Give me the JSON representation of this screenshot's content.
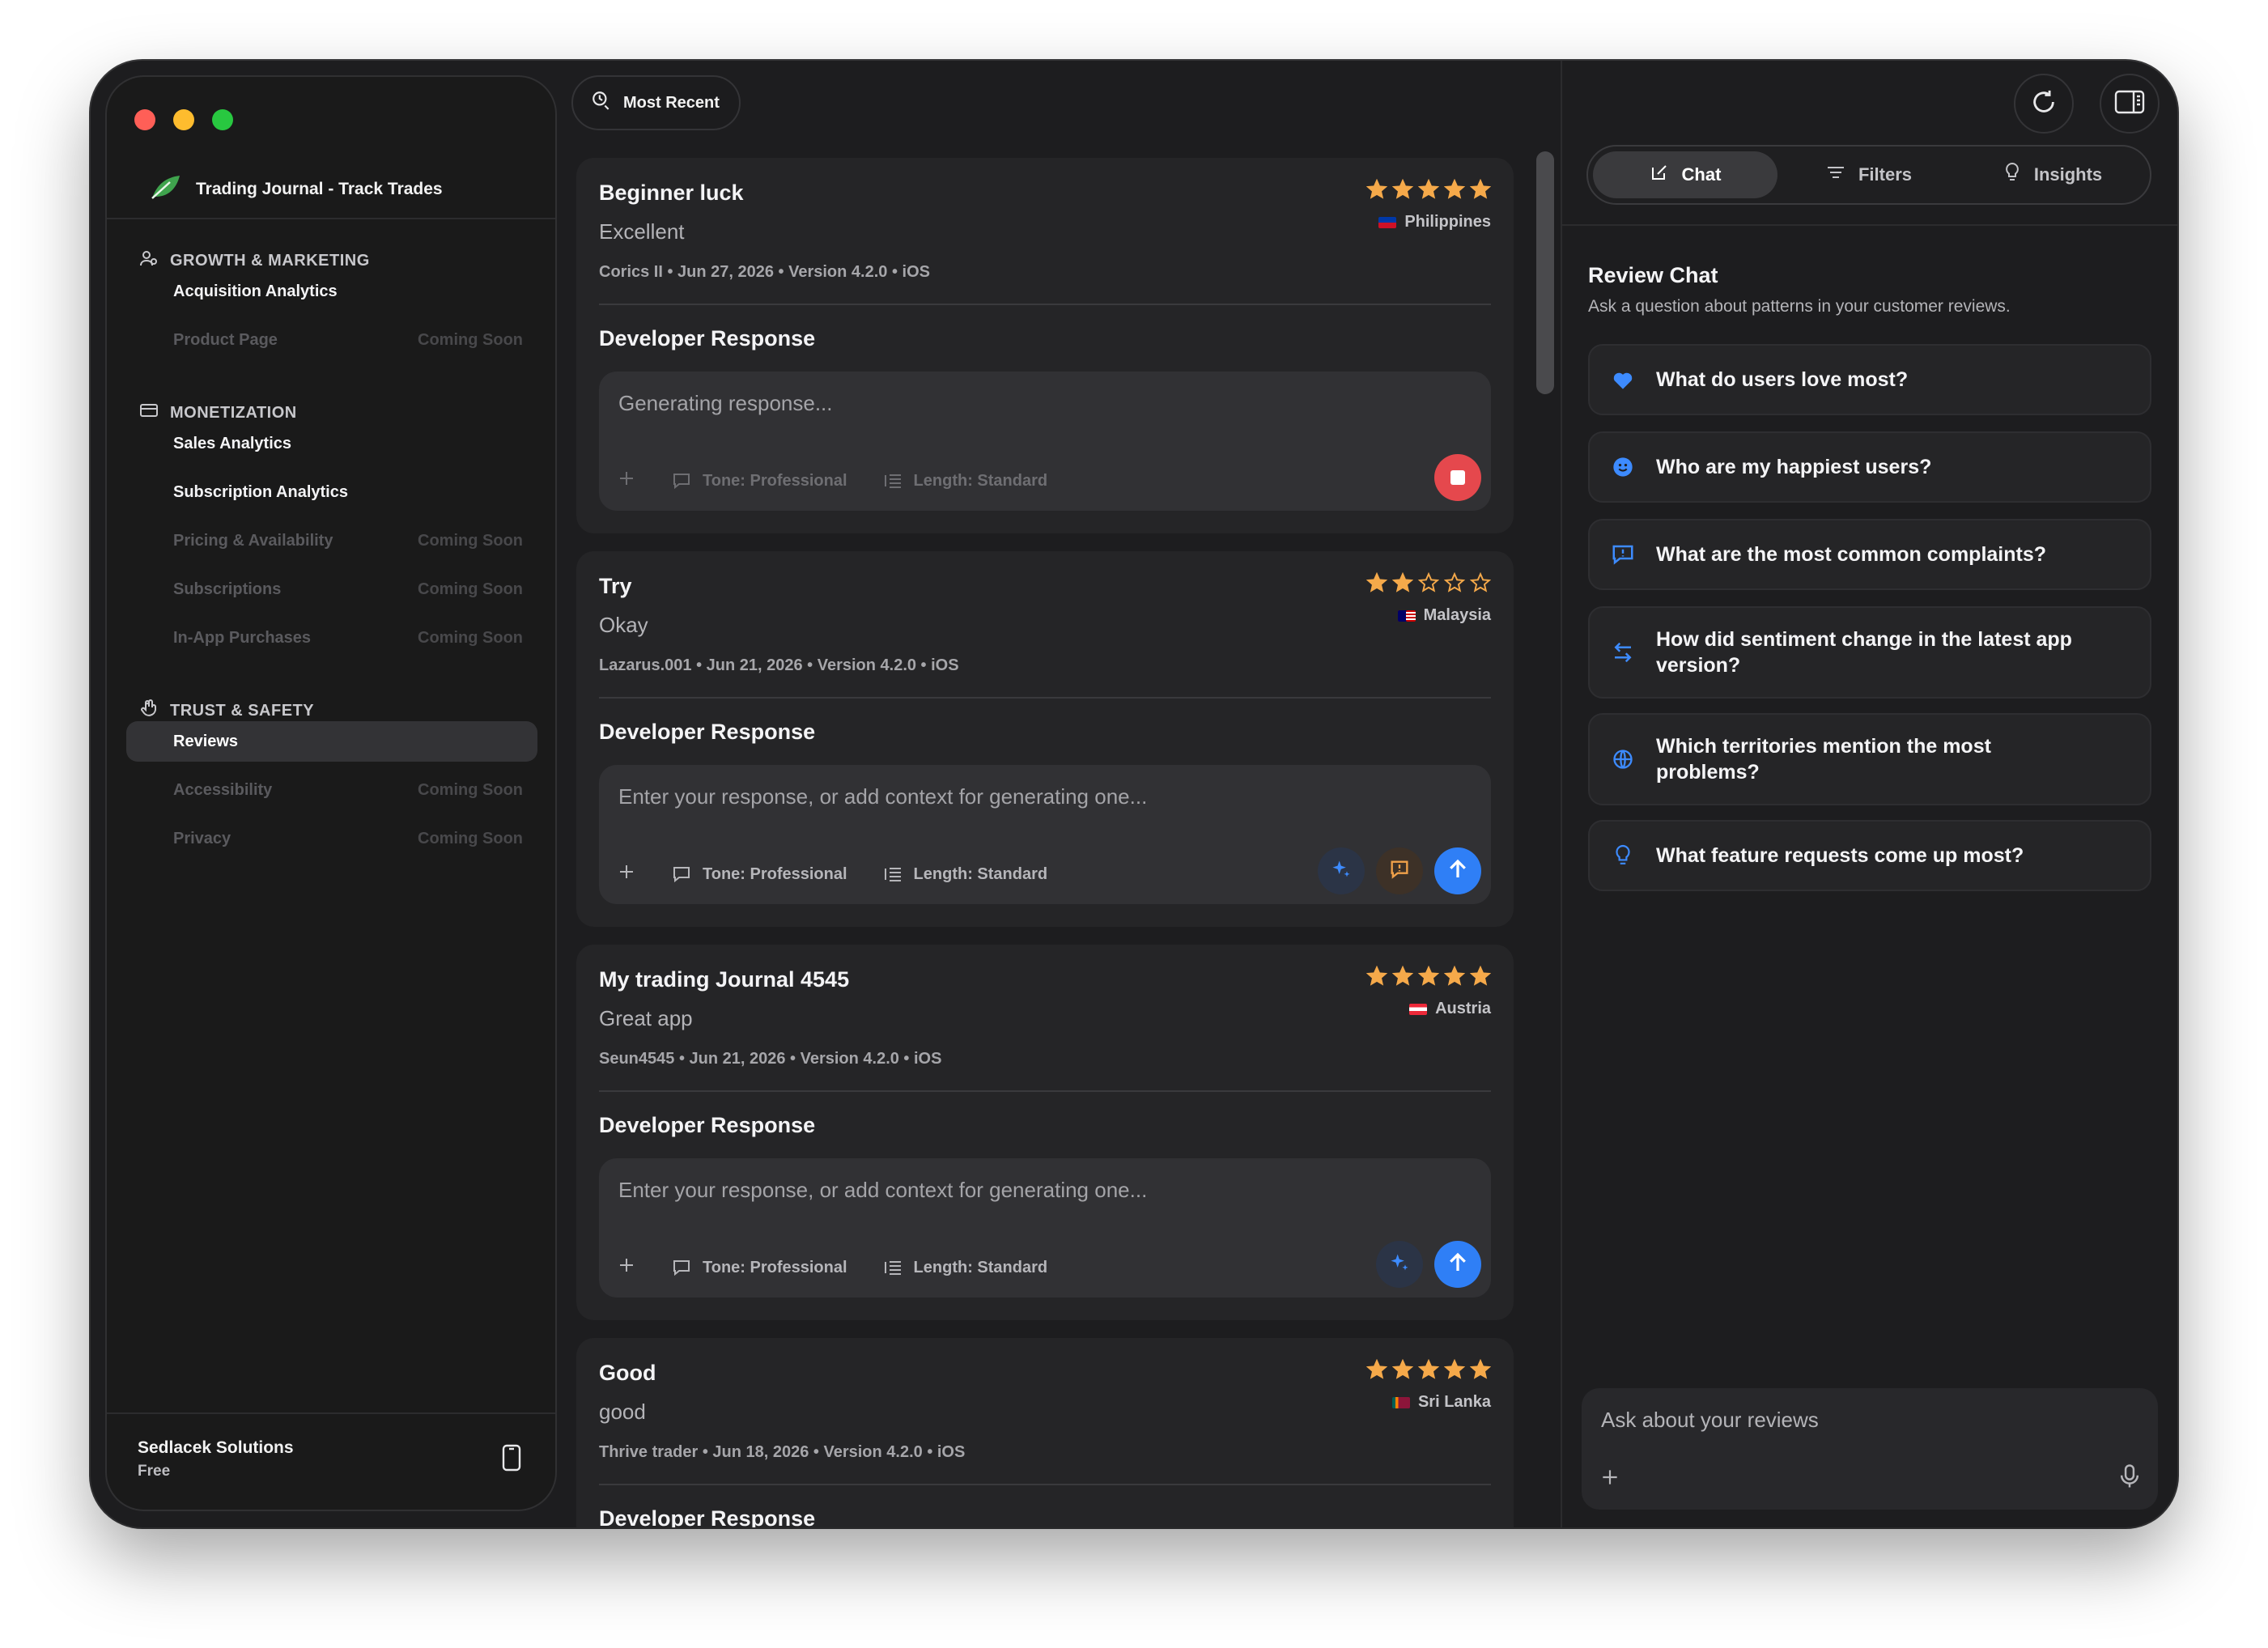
{
  "sidebar": {
    "app_title": "Trading Journal - Track Trades",
    "sections": [
      {
        "title": "GROWTH & MARKETING"
      },
      {
        "title": "MONETIZATION"
      },
      {
        "title": "TRUST & SAFETY"
      }
    ],
    "items": [
      {
        "label": "Acquisition Analytics",
        "badge": ""
      },
      {
        "label": "Product Page",
        "badge": "Coming Soon"
      },
      {
        "label": "Sales Analytics",
        "badge": ""
      },
      {
        "label": "Subscription Analytics",
        "badge": ""
      },
      {
        "label": "Pricing & Availability",
        "badge": "Coming Soon"
      },
      {
        "label": "Subscriptions",
        "badge": "Coming Soon"
      },
      {
        "label": "In-App Purchases",
        "badge": "Coming Soon"
      },
      {
        "label": "Reviews",
        "badge": ""
      },
      {
        "label": "Accessibility",
        "badge": "Coming Soon"
      },
      {
        "label": "Privacy",
        "badge": "Coming Soon"
      }
    ],
    "footer": {
      "org": "Sedlacek Solutions",
      "plan": "Free"
    }
  },
  "toolbar": {
    "sort_label": "Most Recent"
  },
  "reviews": [
    {
      "title": "Beginner luck",
      "subtitle": "Excellent",
      "rating": 5,
      "country": "Philippines",
      "meta": "Corics II  •  Jun 27, 2026 • Version 4.2.0 • iOS",
      "response_heading": "Developer Response",
      "response_text": "Generating response...",
      "tone": "Tone: Professional",
      "length": "Length: Standard"
    },
    {
      "title": "Try",
      "subtitle": "Okay",
      "rating": 2,
      "country": "Malaysia",
      "meta": "Lazarus.001  •  Jun 21, 2026 • Version 4.2.0 • iOS",
      "response_heading": "Developer Response",
      "response_placeholder": "Enter your response, or add context for generating one...",
      "tone": "Tone: Professional",
      "length": "Length: Standard"
    },
    {
      "title": "My trading Journal 4545",
      "subtitle": "Great app",
      "rating": 5,
      "country": "Austria",
      "meta": "Seun4545  •  Jun 21, 2026 • Version 4.2.0 • iOS",
      "response_heading": "Developer Response",
      "response_placeholder": "Enter your response, or add context for generating one...",
      "tone": "Tone: Professional",
      "length": "Length: Standard"
    },
    {
      "title": "Good",
      "subtitle": "good",
      "rating": 5,
      "country": "Sri Lanka",
      "meta": "Thrive trader  •  Jun 18, 2026 • Version 4.2.0 • iOS",
      "response_heading": "Developer Response"
    }
  ],
  "right_panel": {
    "tabs": [
      {
        "label": "Chat"
      },
      {
        "label": "Filters"
      },
      {
        "label": "Insights"
      }
    ],
    "title": "Review Chat",
    "subtitle": "Ask a question about patterns in your customer reviews.",
    "suggestions": [
      {
        "text": "What do users love most?",
        "icon": "heart-icon"
      },
      {
        "text": "Who are my happiest users?",
        "icon": "smiley-icon"
      },
      {
        "text": "What are the most common complaints?",
        "icon": "feedback-icon"
      },
      {
        "text": "How did sentiment change in the latest app version?",
        "icon": "arrows-icon"
      },
      {
        "text": "Which territories mention the most problems?",
        "icon": "globe-icon"
      },
      {
        "text": "What feature requests come up most?",
        "icon": "lightbulb-icon"
      }
    ],
    "chat_placeholder": "Ask about your reviews"
  },
  "colors": {
    "accent": "#2f7ff6",
    "star": "#f5a94a",
    "stop": "#e5484d",
    "window_bg": "#1d1d1f"
  }
}
